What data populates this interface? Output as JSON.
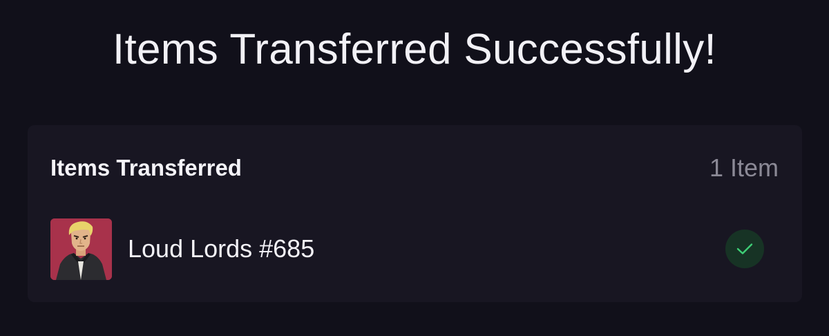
{
  "title": "Items Transferred Successfully!",
  "transfer": {
    "section_title": "Items Transferred",
    "count_label": "1 Item",
    "items": [
      {
        "name": "Loud Lords #685",
        "thumbnail_icon": "character-portrait-icon",
        "status_icon": "check-icon"
      }
    ]
  },
  "colors": {
    "background": "#11101a",
    "card": "#181622",
    "thumbnail_bg": "#a8324b",
    "success": "#3ecf76",
    "success_bg": "#173325",
    "muted_text": "#8b8996"
  }
}
